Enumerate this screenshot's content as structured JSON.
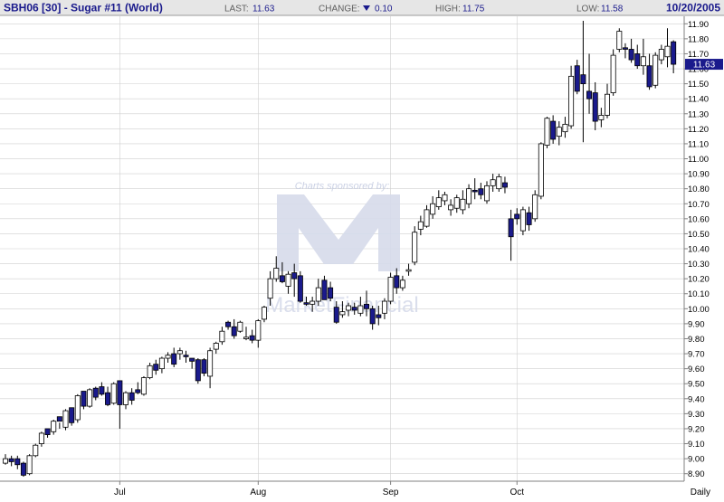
{
  "header": {
    "symbol": "SBH06 [30] - Sugar #11 (World)",
    "last_label": "LAST:",
    "last_value": "11.63",
    "change_label": "CHANGE:",
    "change_value": "0.10",
    "high_label": "HIGH:",
    "high_value": "11.75",
    "low_label": "LOW:",
    "low_value": "11.58",
    "date": "10/20/2005"
  },
  "watermark": {
    "sponsor_text": "Charts sponsored by:",
    "brand_text": "MarketFinancial"
  },
  "colors": {
    "up_fill": "#ffffff",
    "down_fill": "#1a1a8c",
    "candle_outline": "#000000",
    "grid": "#cfcfcf",
    "header_bg": "#e6e6e6",
    "header_text": "#1a1a8c",
    "last_price_bg": "#1a1a8c",
    "watermark": "#cdd3e6"
  },
  "chart_data": {
    "type": "candlestick",
    "frequency_label": "Daily",
    "ylim": [
      8.85,
      11.95
    ],
    "y_ticks": [
      "8.90",
      "9.00",
      "9.10",
      "9.20",
      "9.30",
      "9.40",
      "9.50",
      "9.60",
      "9.70",
      "9.80",
      "9.90",
      "10.00",
      "10.10",
      "10.20",
      "10.30",
      "10.40",
      "10.50",
      "10.60",
      "10.70",
      "10.80",
      "10.90",
      "11.00",
      "11.10",
      "11.20",
      "11.30",
      "11.40",
      "11.50",
      "11.60",
      "11.70",
      "11.80",
      "11.90"
    ],
    "month_labels": [
      {
        "label": "Jul",
        "index": 19
      },
      {
        "label": "Aug",
        "index": 42
      },
      {
        "label": "Sep",
        "index": 64
      },
      {
        "label": "Oct",
        "index": 85
      }
    ],
    "last_price_label": "11.63",
    "last_price": 11.63,
    "ohlc": [
      [
        8.97,
        9.03,
        8.96,
        9.0
      ],
      [
        9.0,
        9.02,
        8.95,
        8.98
      ],
      [
        9.0,
        9.02,
        8.93,
        8.96
      ],
      [
        8.97,
        8.98,
        8.88,
        8.89
      ],
      [
        8.9,
        9.03,
        8.89,
        9.02
      ],
      [
        9.02,
        9.1,
        9.01,
        9.09
      ],
      [
        9.1,
        9.18,
        9.08,
        9.17
      ],
      [
        9.2,
        9.17,
        9.14,
        9.16
      ],
      [
        9.18,
        9.26,
        9.16,
        9.25
      ],
      [
        9.28,
        9.24,
        9.2,
        9.25
      ],
      [
        9.21,
        9.33,
        9.19,
        9.32
      ],
      [
        9.34,
        9.24,
        9.22,
        9.24
      ],
      [
        9.26,
        9.43,
        9.24,
        9.42
      ],
      [
        9.45,
        9.44,
        9.33,
        9.35
      ],
      [
        9.35,
        9.47,
        9.34,
        9.46
      ],
      [
        9.47,
        9.48,
        9.39,
        9.41
      ],
      [
        9.48,
        9.51,
        9.42,
        9.43
      ],
      [
        9.44,
        9.48,
        9.35,
        9.36
      ],
      [
        9.37,
        9.51,
        9.36,
        9.5
      ],
      [
        9.52,
        9.5,
        9.2,
        9.36
      ],
      [
        9.36,
        9.45,
        9.33,
        9.44
      ],
      [
        9.44,
        9.47,
        9.36,
        9.39
      ],
      [
        9.46,
        9.51,
        9.43,
        9.44
      ],
      [
        9.43,
        9.55,
        9.42,
        9.54
      ],
      [
        9.54,
        9.64,
        9.53,
        9.62
      ],
      [
        9.63,
        9.66,
        9.56,
        9.59
      ],
      [
        9.6,
        9.68,
        9.57,
        9.67
      ],
      [
        9.67,
        9.71,
        9.64,
        9.69
      ],
      [
        9.7,
        9.74,
        9.61,
        9.63
      ],
      [
        9.7,
        9.74,
        9.66,
        9.72
      ],
      [
        9.69,
        9.72,
        9.64,
        9.68
      ],
      [
        9.67,
        9.67,
        9.6,
        9.65
      ],
      [
        9.66,
        9.67,
        9.5,
        9.52
      ],
      [
        9.66,
        9.67,
        9.55,
        9.57
      ],
      [
        9.55,
        9.74,
        9.47,
        9.72
      ],
      [
        9.73,
        9.78,
        9.7,
        9.77
      ],
      [
        9.78,
        9.88,
        9.76,
        9.85
      ],
      [
        9.91,
        9.92,
        9.86,
        9.88
      ],
      [
        9.88,
        9.93,
        9.8,
        9.82
      ],
      [
        9.85,
        9.92,
        9.84,
        9.91
      ],
      [
        9.8,
        9.88,
        9.79,
        9.81
      ],
      [
        9.82,
        9.86,
        9.77,
        9.79
      ],
      [
        9.79,
        9.93,
        9.74,
        9.92
      ],
      [
        9.93,
        10.02,
        9.91,
        10.01
      ],
      [
        10.07,
        10.25,
        10.02,
        10.2
      ],
      [
        10.2,
        10.35,
        10.18,
        10.27
      ],
      [
        10.22,
        10.31,
        10.17,
        10.18
      ],
      [
        10.15,
        10.25,
        10.1,
        10.23
      ],
      [
        10.24,
        10.3,
        10.08,
        10.2
      ],
      [
        10.22,
        10.25,
        10.04,
        10.05
      ],
      [
        10.04,
        10.08,
        10.02,
        10.03
      ],
      [
        10.03,
        10.08,
        9.98,
        10.05
      ],
      [
        10.05,
        10.2,
        10.02,
        10.14
      ],
      [
        10.19,
        10.22,
        10.06,
        10.06
      ],
      [
        10.14,
        10.18,
        10.05,
        10.07
      ],
      [
        10.01,
        10.05,
        9.9,
        9.91
      ],
      [
        9.96,
        10.05,
        9.94,
        9.98
      ],
      [
        9.99,
        10.04,
        9.95,
        10.02
      ],
      [
        10.01,
        10.04,
        9.96,
        9.99
      ],
      [
        9.97,
        10.08,
        9.95,
        10.02
      ],
      [
        10.03,
        10.12,
        9.95,
        10.0
      ],
      [
        10.0,
        10.02,
        9.86,
        9.9
      ],
      [
        9.96,
        10.02,
        9.89,
        9.94
      ],
      [
        9.97,
        10.07,
        9.93,
        10.05
      ],
      [
        10.05,
        10.24,
        10.03,
        10.21
      ],
      [
        10.22,
        10.27,
        10.1,
        10.14
      ],
      [
        10.14,
        10.22,
        10.12,
        10.19
      ],
      [
        10.25,
        10.3,
        10.22,
        10.26
      ],
      [
        10.31,
        10.55,
        10.29,
        10.51
      ],
      [
        10.53,
        10.62,
        10.49,
        10.58
      ],
      [
        10.55,
        10.69,
        10.54,
        10.66
      ],
      [
        10.63,
        10.75,
        10.6,
        10.7
      ],
      [
        10.68,
        10.79,
        10.66,
        10.74
      ],
      [
        10.72,
        10.78,
        10.69,
        10.76
      ],
      [
        10.66,
        10.73,
        10.62,
        10.69
      ],
      [
        10.67,
        10.76,
        10.64,
        10.74
      ],
      [
        10.66,
        10.79,
        10.63,
        10.73
      ],
      [
        10.7,
        10.83,
        10.67,
        10.8
      ],
      [
        10.79,
        10.87,
        10.73,
        10.78
      ],
      [
        10.8,
        10.84,
        10.73,
        10.76
      ],
      [
        10.72,
        10.85,
        10.7,
        10.82
      ],
      [
        10.82,
        10.9,
        10.78,
        10.86
      ],
      [
        10.8,
        10.9,
        10.78,
        10.88
      ],
      [
        10.84,
        10.88,
        10.77,
        10.81
      ],
      [
        10.6,
        10.66,
        10.32,
        10.48
      ],
      [
        10.63,
        10.67,
        10.56,
        10.6
      ],
      [
        10.52,
        10.68,
        10.49,
        10.66
      ],
      [
        10.64,
        10.68,
        10.52,
        10.56
      ],
      [
        10.6,
        10.79,
        10.58,
        10.76
      ],
      [
        10.75,
        11.11,
        10.73,
        11.1
      ],
      [
        11.09,
        11.28,
        11.07,
        11.27
      ],
      [
        11.25,
        11.29,
        11.1,
        11.13
      ],
      [
        11.15,
        11.25,
        11.09,
        11.21
      ],
      [
        11.18,
        11.28,
        11.14,
        11.23
      ],
      [
        11.22,
        11.62,
        11.2,
        11.55
      ],
      [
        11.62,
        11.66,
        11.43,
        11.45
      ],
      [
        11.56,
        11.92,
        11.11,
        11.5
      ],
      [
        11.45,
        11.7,
        11.3,
        11.4
      ],
      [
        11.44,
        11.51,
        11.19,
        11.25
      ],
      [
        11.26,
        11.34,
        11.21,
        11.29
      ],
      [
        11.29,
        11.5,
        11.27,
        11.43
      ],
      [
        11.44,
        11.73,
        11.42,
        11.69
      ],
      [
        11.73,
        11.87,
        11.71,
        11.85
      ],
      [
        11.74,
        11.77,
        11.67,
        11.73
      ],
      [
        11.73,
        11.8,
        11.64,
        11.66
      ],
      [
        11.7,
        11.76,
        11.6,
        11.62
      ],
      [
        11.62,
        11.8,
        11.56,
        11.68
      ],
      [
        11.62,
        11.7,
        11.46,
        11.48
      ],
      [
        11.49,
        11.71,
        11.47,
        11.69
      ],
      [
        11.66,
        11.76,
        11.63,
        11.73
      ],
      [
        11.68,
        11.87,
        11.61,
        11.75
      ],
      [
        11.78,
        11.79,
        11.57,
        11.63
      ]
    ]
  }
}
